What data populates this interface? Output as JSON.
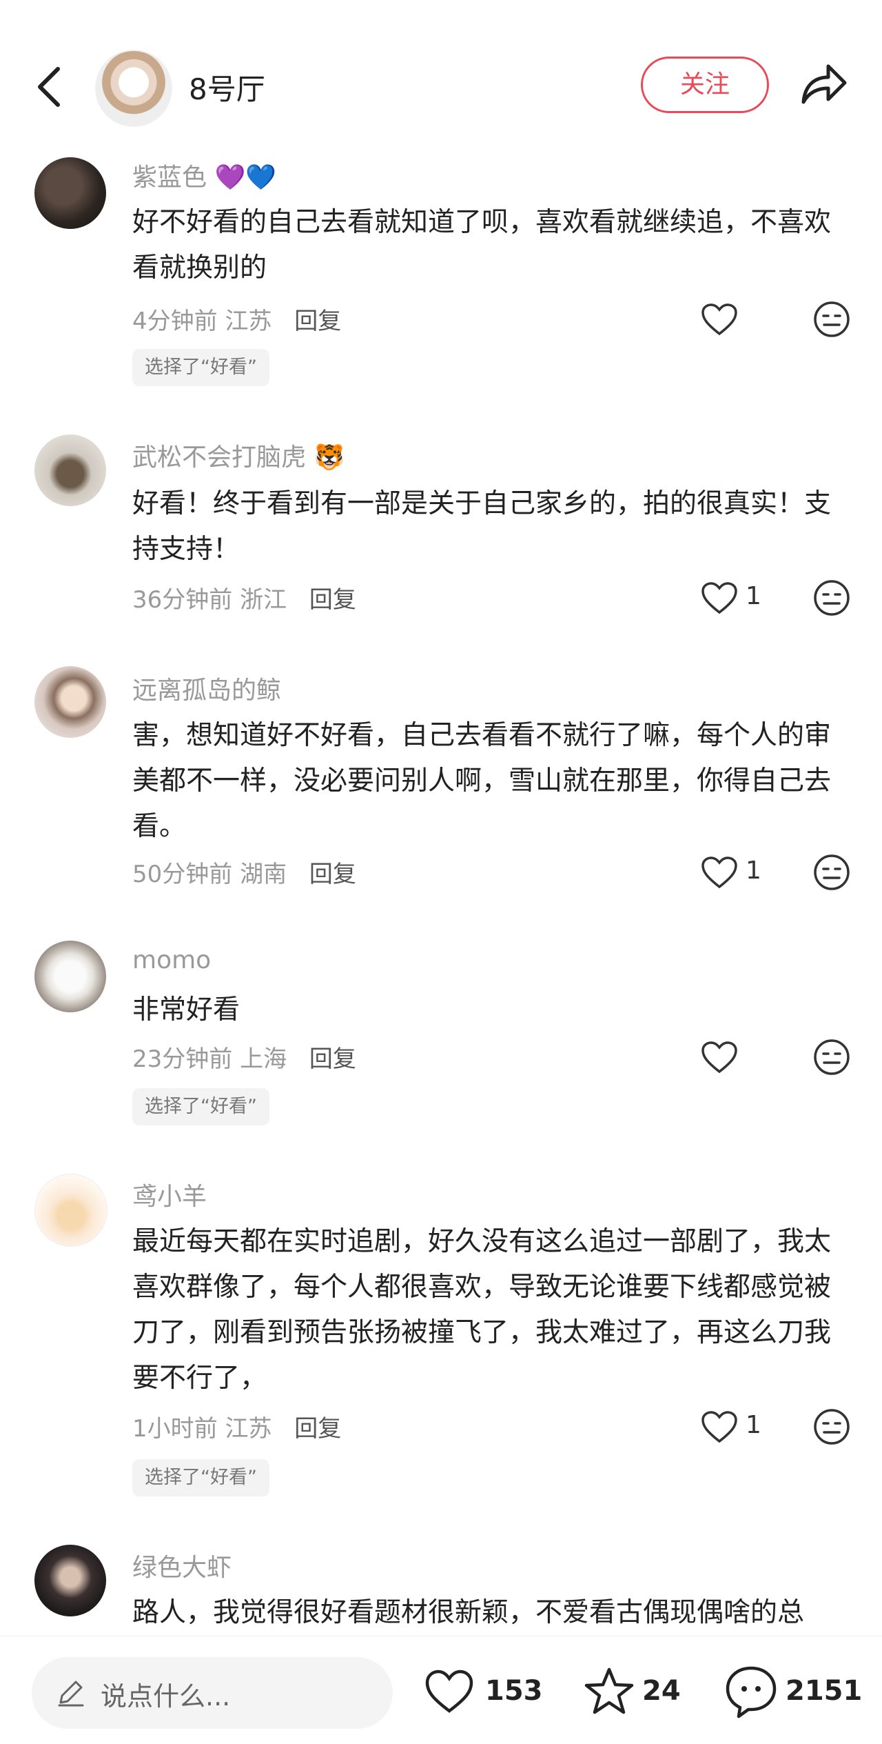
{
  "header": {
    "title": "8号厅",
    "follow_label": "关注"
  },
  "comments": [
    {
      "username": "紫蓝色",
      "badges": "💜💙",
      "text": "好不好看的自己去看就知道了呗，喜欢看就继续追，不喜欢看就换别的",
      "time": "4分钟前",
      "location": "江苏",
      "reply": "回复",
      "likes": "",
      "tag": "选择了“好看”"
    },
    {
      "username": "武松不会打脑虎",
      "badges": "🐯",
      "text": "好看！终于看到有一部是关于自己家乡的，拍的很真实！支持支持！",
      "time": "36分钟前",
      "location": "浙江",
      "reply": "回复",
      "likes": "1",
      "tag": ""
    },
    {
      "username": "远离孤岛的鲸",
      "badges": "",
      "text": "害，想知道好不好看，自己去看看不就行了嘛，每个人的审美都不一样，没必要问别人啊，雪山就在那里，你得自己去看。",
      "time": "50分钟前",
      "location": "湖南",
      "reply": "回复",
      "likes": "1",
      "tag": ""
    },
    {
      "username": "momo",
      "badges": "",
      "text": "非常好看",
      "time": "23分钟前",
      "location": "上海",
      "reply": "回复",
      "likes": "",
      "tag": "选择了“好看”"
    },
    {
      "username": "鸢小羊",
      "badges": "",
      "text": "最近每天都在实时追剧，好久没有这么追过一部剧了，我太喜欢群像了，每个人都很喜欢，导致无论谁要下线都感觉被刀了，刚看到预告张扬被撞飞了，我太难过了，再这么刀我要不行了，",
      "time": "1小时前",
      "location": "江苏",
      "reply": "回复",
      "likes": "1",
      "tag": "选择了“好看”"
    },
    {
      "username": "绿色大虾",
      "badges": "",
      "text": "路人，我觉得很好看题材很新颖，不爱看古偶现偶啥的总"
    }
  ],
  "bottom": {
    "input_placeholder": "说点什么...",
    "likes": "153",
    "favorites": "24",
    "comments": "2151"
  }
}
